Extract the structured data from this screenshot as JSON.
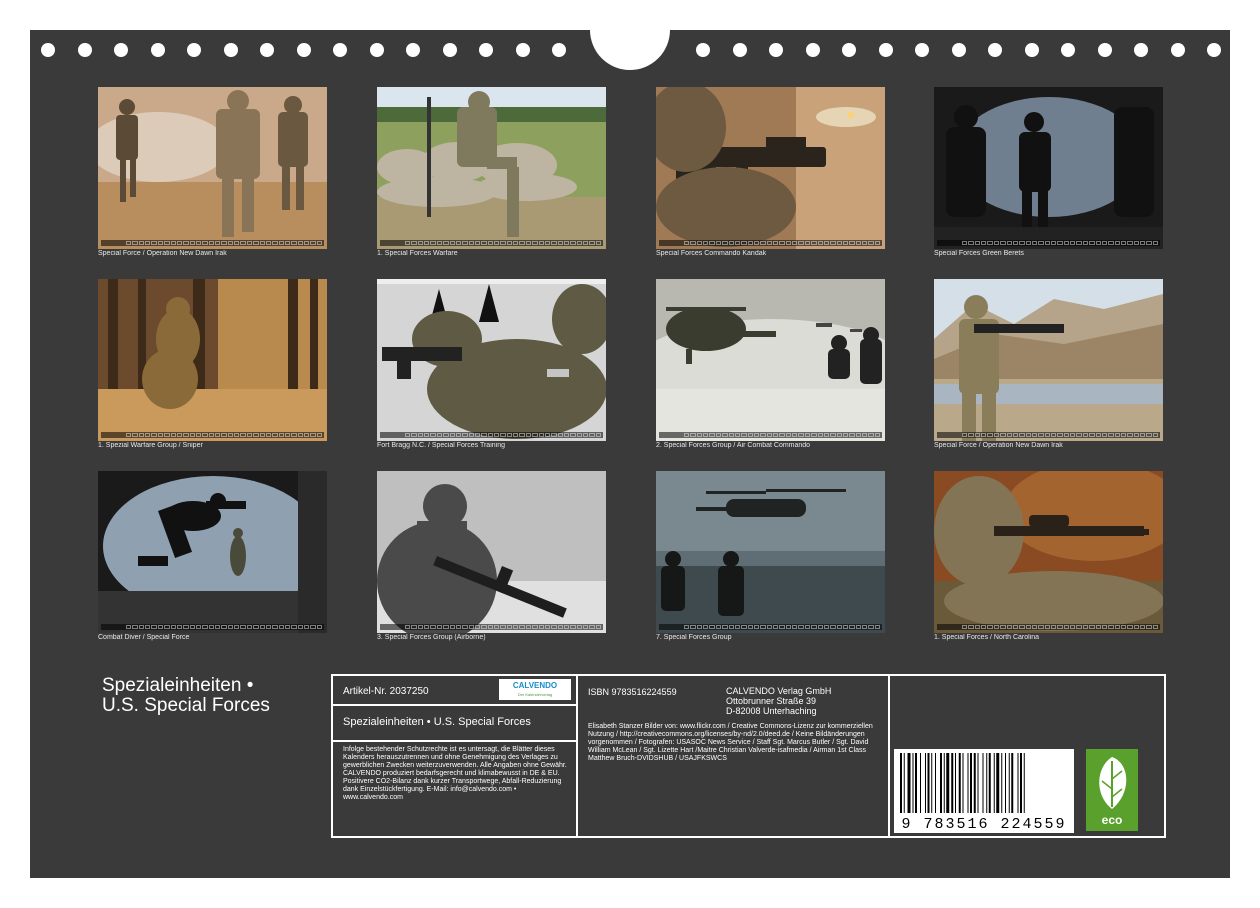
{
  "thumbnails": [
    {
      "caption": "Special Force / Operation New Dawn Irak",
      "scene": "soldiers-running"
    },
    {
      "caption": "1. Special Forces Warfare",
      "scene": "soldier-behind-wall"
    },
    {
      "caption": "Special Forces Commando Kandak",
      "scene": "rifle-firing-closeup"
    },
    {
      "caption": "Special Forces Green Berets",
      "scene": "aircraft-ramp-jump"
    },
    {
      "caption": "1. Spezial Warfare Group / Sniper",
      "scene": "sniper-forest"
    },
    {
      "caption": "Fort Bragg N.C. / Special Forces Training",
      "scene": "soldier-aiming-targets"
    },
    {
      "caption": "2. Special Forces Group / Air Combat Commando",
      "scene": "helicopter-snow"
    },
    {
      "caption": "Special Force / Operation New Dawn Irak",
      "scene": "soldier-mountains"
    },
    {
      "caption": "Combat Diver / Special Force",
      "scene": "freefall-jump"
    },
    {
      "caption": "3. Special Forces Group (Airborne)",
      "scene": "soldier-bw-rifle"
    },
    {
      "caption": "7. Special Forces Group",
      "scene": "helicopter-sea"
    },
    {
      "caption": "1. Special Forces / North Carolina",
      "scene": "sniper-scope"
    }
  ],
  "title": {
    "line1": "Spezialeinheiten •",
    "line2": "U.S. Special Forces"
  },
  "info": {
    "artikel": "Artikel-Nr. 2037250",
    "logo_text": "CALVENDO",
    "logo_sub": "Der Kalenderverlag",
    "product_title": "Spezialeinheiten • U.S. Special Forces",
    "legal_text": "Infolge bestehender Schutzrechte ist es untersagt, die Blätter dieses Kalenders herauszutrennen und ohne Genehmigung des Verlages zu gewerblichen Zwecken weiterzuverwenden. Alle Angaben ohne Gewähr. CALVENDO produziert bedarfsgerecht und klimabewusst in DE & EU. Positivere CO2-Bilanz dank kurzer Transportwege, Abfall-Reduzierung dank Einzelstückfertigung. E-Mail: info@calvendo.com • www.calvendo.com",
    "isbn": "ISBN 9783516224559",
    "publisher_name": "CALVENDO Verlag GmbH",
    "publisher_street": "Ottobrunner Straße 39",
    "publisher_city": "D-82008 Unterhaching",
    "credits": "Elisabeth Stanzer Bilder von: www.flickr.com / Creative Commons-Lizenz zur kommerziellen Nutzung / http://creativecommons.org/licenses/by-nd/2.0/deed.de / Keine Bildänderungen vorgenommen / Fotografen: USASOC News Service / Staff Sgt. Marcus Butler / Sgt. David William McLean / Sgt. Lizette Hart /Maitre Christian Valverde-isafmedia / Airman 1st Class Matthew Bruch-DVIDSHUB / USAJFKSWCS",
    "barcode_digits": "9 783516 224559",
    "eco_label": "eco"
  }
}
